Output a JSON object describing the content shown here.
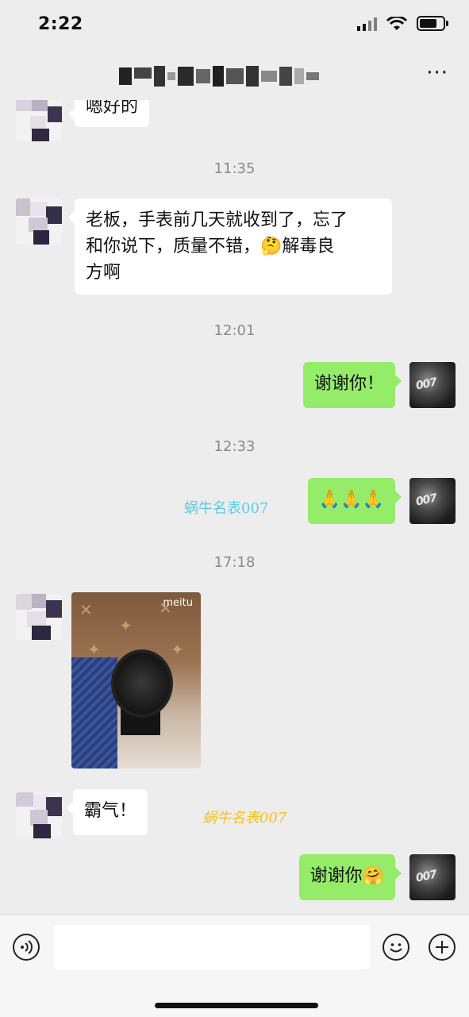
{
  "status_bar": {
    "time": "2:22"
  },
  "nav": {
    "more_label": "···"
  },
  "messages": {
    "m0": {
      "text": "嗯好的"
    },
    "t1": {
      "time": "11:35"
    },
    "m1": {
      "line1": "老板，手表前几天就收到了，忘了",
      "line2_a": "和你说下，质量不错，",
      "line2_emoji": "🤔",
      "line2_b": "解毒良",
      "line3": "方啊"
    },
    "t2": {
      "time": "12:01"
    },
    "m2": {
      "text": "谢谢你！"
    },
    "t3": {
      "time": "12:33"
    },
    "m3": {
      "text": "🙏🙏🙏"
    },
    "watermark1": "蜗牛名表007",
    "t4": {
      "time": "17:18"
    },
    "photo": {
      "label": "meitu"
    },
    "m5": {
      "text": "霸气！"
    },
    "watermark2": "蜗牛名表007",
    "m6": {
      "text": "谢谢你",
      "emoji": "🤗"
    }
  },
  "my_avatar": {
    "logo_text": "007"
  },
  "colors": {
    "background": "#ededed",
    "my_bubble": "#95ec69",
    "their_bubble": "#ffffff",
    "watermark1": "#5ecbe8",
    "watermark2": "#f3c21b"
  },
  "icons": {
    "voice": "voice-icon",
    "emoji": "emoji-icon",
    "add": "add-icon"
  }
}
